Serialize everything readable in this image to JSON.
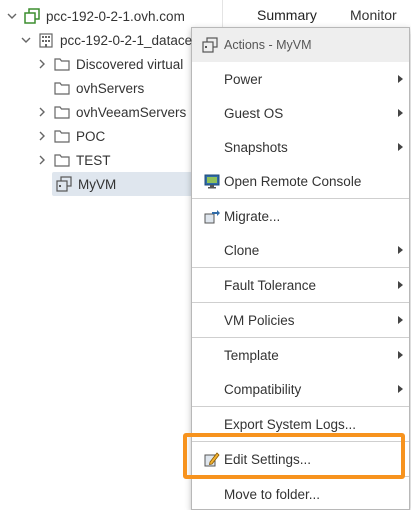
{
  "tree": {
    "root": {
      "label": "pcc-192-0-2-1.ovh.com",
      "icon": "vcenter-icon"
    },
    "datacenter": {
      "label": "pcc-192-0-2-1_datace",
      "icon": "datacenter-icon"
    },
    "folders": [
      {
        "label": "Discovered virtual",
        "icon": "folder-icon",
        "expandable": true
      },
      {
        "label": "ovhServers",
        "icon": "folder-icon",
        "expandable": false
      },
      {
        "label": "ovhVeeamServers",
        "icon": "folder-icon",
        "expandable": true
      },
      {
        "label": "POC",
        "icon": "folder-icon",
        "expandable": true
      },
      {
        "label": "TEST",
        "icon": "folder-icon",
        "expandable": true
      }
    ],
    "selected_vm": {
      "label": "MyVM",
      "icon": "vm-icon"
    }
  },
  "tabs": [
    {
      "label": "Summary"
    },
    {
      "label": "Monitor"
    }
  ],
  "menu": {
    "header": "Actions - MyVM",
    "items": [
      {
        "label": "Power",
        "submenu": true,
        "icon": ""
      },
      {
        "label": "Guest OS",
        "submenu": true,
        "icon": ""
      },
      {
        "label": "Snapshots",
        "submenu": true,
        "icon": ""
      },
      {
        "label": "Open Remote Console",
        "submenu": false,
        "icon": "remote-console-icon"
      },
      {
        "label": "Migrate...",
        "submenu": false,
        "icon": "migrate-icon"
      },
      {
        "label": "Clone",
        "submenu": true,
        "icon": ""
      },
      {
        "label": "Fault Tolerance",
        "submenu": true,
        "icon": ""
      },
      {
        "label": "VM Policies",
        "submenu": true,
        "icon": ""
      },
      {
        "label": "Template",
        "submenu": true,
        "icon": ""
      },
      {
        "label": "Compatibility",
        "submenu": true,
        "icon": ""
      },
      {
        "label": "Export System Logs...",
        "submenu": false,
        "icon": ""
      },
      {
        "label": "Edit Settings...",
        "submenu": false,
        "icon": "edit-settings-icon"
      },
      {
        "label": "Move to folder...",
        "submenu": false,
        "icon": ""
      }
    ]
  },
  "colors": {
    "highlight": "#f7931e",
    "selection": "#dfe6ee",
    "vcenter_green": "#3c8d2f"
  }
}
